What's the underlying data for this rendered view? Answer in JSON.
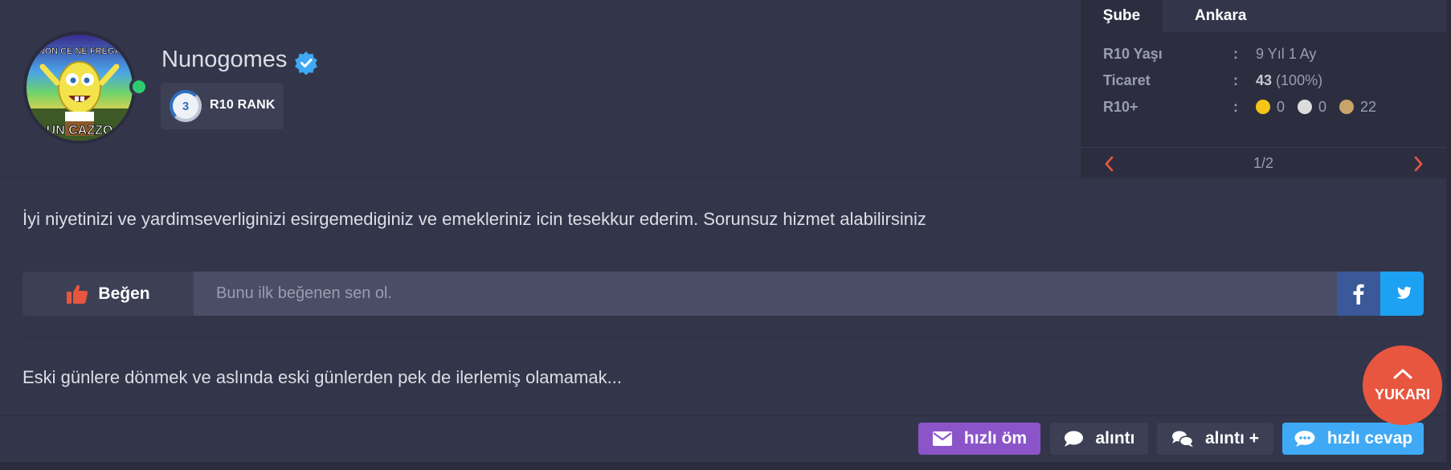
{
  "user": {
    "name": "Nunogomes",
    "avatar_caption_top": "NON CE NE FREGA",
    "avatar_caption_bottom": "UN CAZZO",
    "rank_number": "3",
    "rank_label": "R10 RANK"
  },
  "info_panel": {
    "tab_label": "Şube",
    "tab_value": "Ankara",
    "rows": [
      {
        "key": "R10 Yaşı",
        "colon": ":",
        "value": "9 Yıl 1 Ay"
      },
      {
        "key": "Ticaret",
        "colon": ":",
        "value_bold": "43",
        "value_rest": "(100%)"
      },
      {
        "key": "R10+",
        "colon": ":",
        "gold": "0",
        "silver": "0",
        "bronze": "22"
      }
    ],
    "page_indicator": "1/2"
  },
  "post": {
    "message": "İyi niyetinizi ve yardimseverliginizi esirgemediginiz ve emekleriniz icin tesekkur ederim. Sorunsuz hizmet alabilirsiniz",
    "signature": "Eski günlere dönmek ve aslında eski günlerden pek de ilerlemiş olamamak..."
  },
  "likebar": {
    "like_label": "Beğen",
    "like_text": "Bunu ilk beğenen sen ol."
  },
  "actions": {
    "pm_label": "hızlı öm",
    "quote_label": "alıntı",
    "quote_plus_label": "alıntı +",
    "reply_label": "hızlı cevap"
  },
  "scroll_top": {
    "label": "YUKARI"
  },
  "colors": {
    "background": "#33364a",
    "accent_orange": "#e8563f",
    "purple": "#8b55c9",
    "blue": "#3fa9f5",
    "facebook": "#3b5998",
    "twitter": "#1da1f2",
    "online": "#2ecc71",
    "gold": "#f5c518",
    "silver": "#dcdcdc",
    "bronze": "#c9a36a"
  }
}
